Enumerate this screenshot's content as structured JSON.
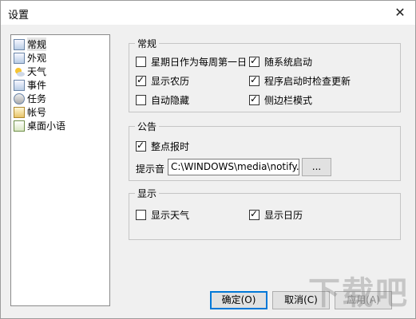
{
  "window": {
    "title": "设置",
    "close_glyph": "✕"
  },
  "tree": {
    "items": [
      {
        "label": "常规",
        "icon": "general-icon"
      },
      {
        "label": "外观",
        "icon": "appearance-icon"
      },
      {
        "label": "天气",
        "icon": "weather-icon"
      },
      {
        "label": "事件",
        "icon": "event-icon"
      },
      {
        "label": "任务",
        "icon": "task-icon"
      },
      {
        "label": "帐号",
        "icon": "account-icon"
      },
      {
        "label": "桌面小语",
        "icon": "desktop-quote-icon"
      }
    ]
  },
  "general": {
    "legend": "常规",
    "options": [
      {
        "label": "星期日作为每周第一日",
        "checked": false
      },
      {
        "label": "随系统启动",
        "checked": true
      },
      {
        "label": "显示农历",
        "checked": true
      },
      {
        "label": "程序启动时检查更新",
        "checked": true
      },
      {
        "label": "自动隐藏",
        "checked": false
      },
      {
        "label": "侧边栏模式",
        "checked": true
      }
    ]
  },
  "announce": {
    "legend": "公告",
    "hourly": {
      "label": "整点报时",
      "checked": true
    },
    "sound_label": "提示音",
    "sound_value": "C:\\WINDOWS\\media\\notify.wa",
    "browse_label": "..."
  },
  "display": {
    "legend": "显示",
    "options": [
      {
        "label": "显示天气",
        "checked": false
      },
      {
        "label": "显示日历",
        "checked": true
      }
    ]
  },
  "footer": {
    "ok": "确定(O)",
    "cancel": "取消(C)",
    "apply": "应用(A)"
  },
  "watermark": "下载吧"
}
